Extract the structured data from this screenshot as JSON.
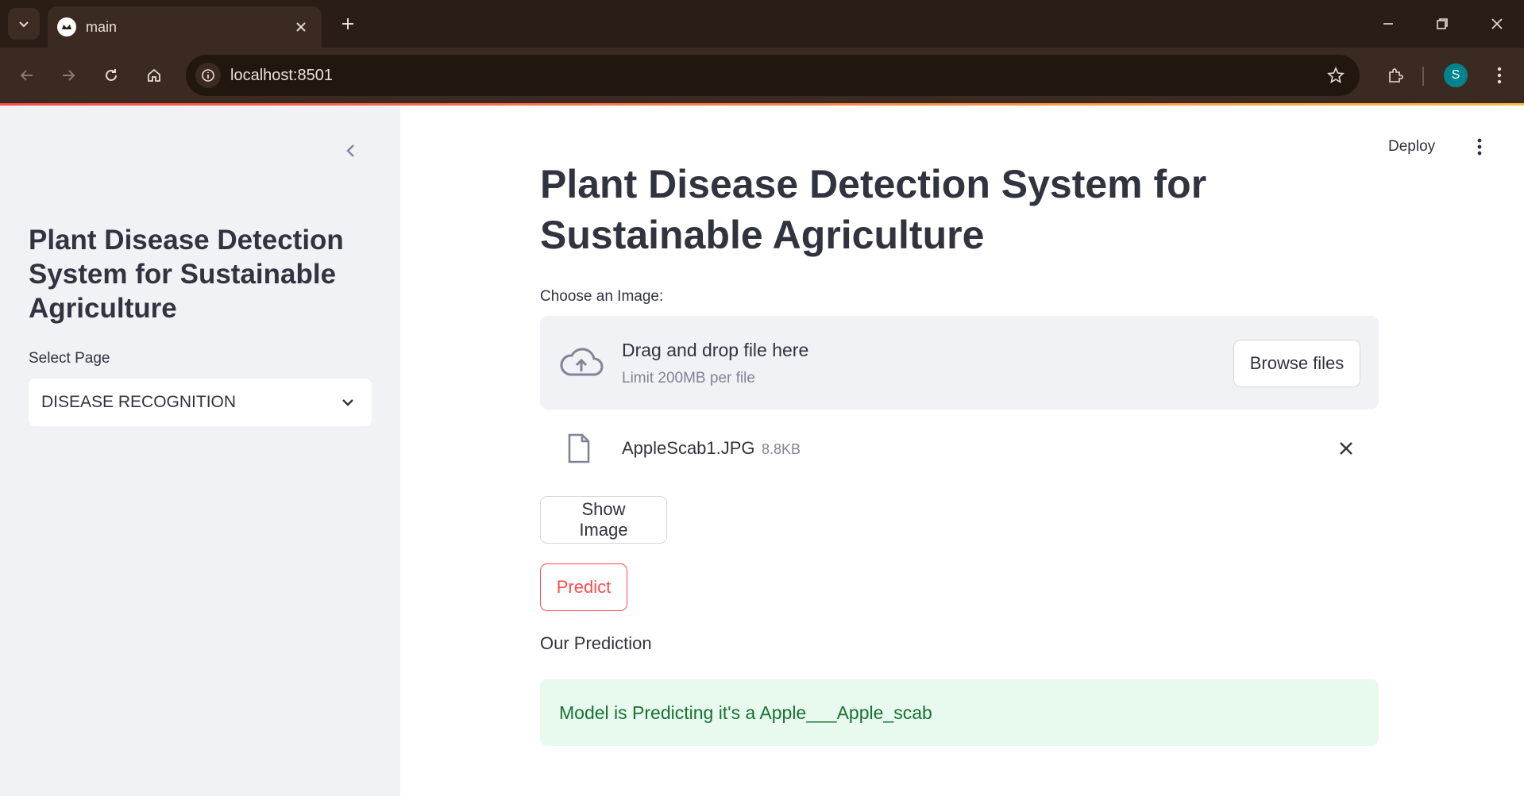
{
  "browser": {
    "tab_title": "main",
    "url": "localhost:8501",
    "profile_initial": "S"
  },
  "header": {
    "deploy_label": "Deploy"
  },
  "sidebar": {
    "title": "Plant Disease Detection System for Sustainable Agriculture",
    "select_label": "Select Page",
    "select_value": "DISEASE RECOGNITION"
  },
  "main": {
    "title": "Plant Disease Detection System for Sustainable Agriculture",
    "uploader": {
      "label": "Choose an Image:",
      "drop_text": "Drag and drop file here",
      "limit_text": "Limit 200MB per file",
      "browse_label": "Browse files"
    },
    "file": {
      "name": "AppleScab1.JPG",
      "size": "8.8KB"
    },
    "show_image_label": "Show Image",
    "predict_label": "Predict",
    "prediction_heading": "Our Prediction",
    "prediction_result": "Model is Predicting it's a Apple___Apple_scab"
  },
  "colors": {
    "accent": "#ff4b4b",
    "success_bg": "#e8f9ee",
    "success_text": "#177233",
    "sidebar_bg": "#f0f2f6",
    "chrome_bg": "#2a1d16"
  }
}
